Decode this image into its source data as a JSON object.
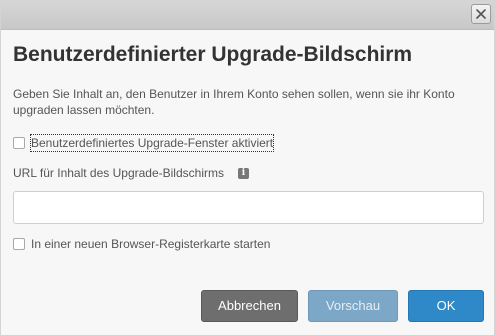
{
  "dialog": {
    "close_icon": "close-icon",
    "heading": "Benutzerdefinierter Upgrade-Bildschirm",
    "description": "Geben Sie Inhalt an, den Benutzer in Ihrem Konto sehen sollen, wenn sie ihr Konto upgraden lassen möchten.",
    "enable_checkbox": {
      "label": "Benutzerdefiniertes Upgrade-Fenster aktiviert",
      "checked": false
    },
    "url_field": {
      "label": "URL für Inhalt des Upgrade-Bildschirms",
      "info_icon": "info-icon",
      "value": ""
    },
    "new_tab_checkbox": {
      "label": "In einer neuen Browser-Registerkarte starten",
      "checked": false
    },
    "buttons": {
      "cancel": "Abbrechen",
      "preview": "Vorschau",
      "ok": "OK"
    }
  }
}
